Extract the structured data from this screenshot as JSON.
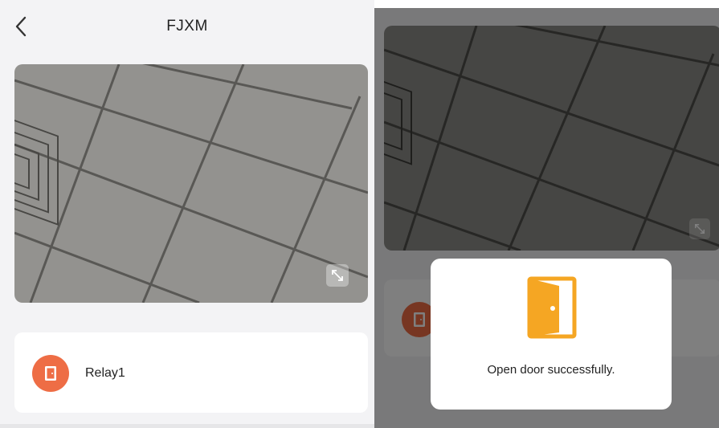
{
  "left_screen": {
    "nav": {
      "title": "FJXM",
      "back_icon": "chevron-left-icon"
    },
    "video": {
      "fullscreen_icon": "expand-icon"
    },
    "relay": {
      "label": "Relay1",
      "icon": "door-icon",
      "icon_color": "#ee6d45"
    }
  },
  "right_screen": {
    "toast": {
      "message": "Open door successfully.",
      "icon": "door-open-icon",
      "icon_color": "#f5a623"
    }
  },
  "colors": {
    "background": "#f3f3f5",
    "card": "#ffffff",
    "accent_orange": "#ee6d45",
    "door_yellow": "#f5a623"
  }
}
